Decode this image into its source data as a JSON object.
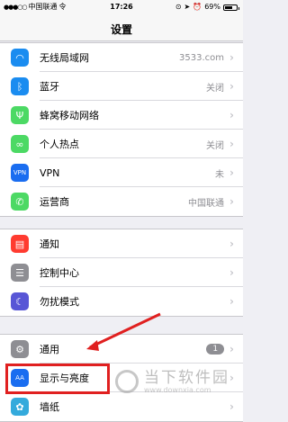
{
  "status_bar": {
    "carrier": "中国联通",
    "network": "令",
    "time": "17:26",
    "battery_percent": "69%",
    "battery_level": 0.69
  },
  "nav": {
    "title": "设置"
  },
  "group1": [
    {
      "label": "无线局域网",
      "value": "3533.com",
      "icon": "wifi-icon",
      "color": "#1a8cf0"
    },
    {
      "label": "蓝牙",
      "value": "关闭",
      "icon": "bluetooth-icon",
      "color": "#1a8cf0"
    },
    {
      "label": "蜂窝移动网络",
      "value": "",
      "icon": "cellular-icon",
      "color": "#4cd964"
    },
    {
      "label": "个人热点",
      "value": "关闭",
      "icon": "hotspot-icon",
      "color": "#4cd964"
    },
    {
      "label": "VPN",
      "value": "未",
      "icon": "vpn-icon",
      "color": "#1a6df0"
    },
    {
      "label": "运营商",
      "value": "中国联通",
      "icon": "phone-icon",
      "color": "#4cd964"
    }
  ],
  "group2": [
    {
      "label": "通知",
      "icon": "notifications-icon",
      "color": "#ff3b30"
    },
    {
      "label": "控制中心",
      "icon": "control-center-icon",
      "color": "#8e8e93"
    },
    {
      "label": "勿扰模式",
      "icon": "moon-icon",
      "color": "#5856d6"
    }
  ],
  "group3": [
    {
      "label": "通用",
      "badge": "1",
      "icon": "gear-icon",
      "color": "#8e8e93"
    },
    {
      "label": "显示与亮度",
      "icon": "display-brightness-icon",
      "color": "#1a6df0"
    },
    {
      "label": "墙纸",
      "icon": "wallpaper-icon",
      "color": "#34aadc"
    }
  ],
  "watermark": {
    "brand": "当下软件园",
    "url": "www.downxia.com"
  }
}
